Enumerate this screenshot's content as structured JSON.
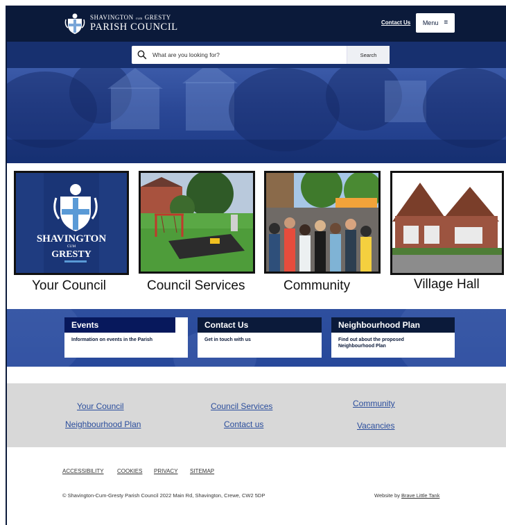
{
  "header": {
    "logo_line1_a": "SHAVINGTON",
    "logo_line1_cum": "cum",
    "logo_line1_b": "GRESTY",
    "logo_line2": "PARISH COUNCIL",
    "contact_link": "Contact Us",
    "menu_label": "Menu",
    "menu_icon": "≡",
    "background": "#0b1a3a"
  },
  "search": {
    "placeholder": "What are you looking for?",
    "button_label": "Search",
    "band_color": "#17306f"
  },
  "tiles": [
    {
      "label": "Your Council",
      "image": "council-crest-logo",
      "crest_line1": "SHAVINGTON",
      "crest_line2": "CUM",
      "crest_line3": "GRESTY"
    },
    {
      "label": "Council Services",
      "image": "playground-photo"
    },
    {
      "label": "Community",
      "image": "crowd-event-photo"
    },
    {
      "label": "Village Hall",
      "image": "village-hall-photo"
    }
  ],
  "cards": [
    {
      "title": "Events",
      "body": "Information on events in the Parish"
    },
    {
      "title": "Contact Us",
      "body": "Get in touch with us"
    },
    {
      "title": "Neighbourhood Plan",
      "body": "Find out about the proposed Neighbourhood Plan"
    }
  ],
  "footer_links": {
    "col1": [
      "Your Council",
      "Neighbourhood Plan"
    ],
    "col2": [
      "Council Services",
      "Contact us"
    ],
    "col3": [
      "Community",
      "Vacancies"
    ]
  },
  "legal_links": [
    "ACCESSIBILITY",
    "COOKIES",
    "PRIVACY",
    "SITEMAP"
  ],
  "copyright": "© Shavington-Cum-Gresty Parish Council 2022 Main Rd, Shavington, Crewe, CW2 5DP",
  "credit_prefix": "Website by ",
  "credit_link": "Brave Little Tank",
  "colors": {
    "navy": "#0b1a3a",
    "brand_blue": "#27489a",
    "link_blue": "#2a4d9c",
    "footer_grey": "#d8d8d8"
  }
}
